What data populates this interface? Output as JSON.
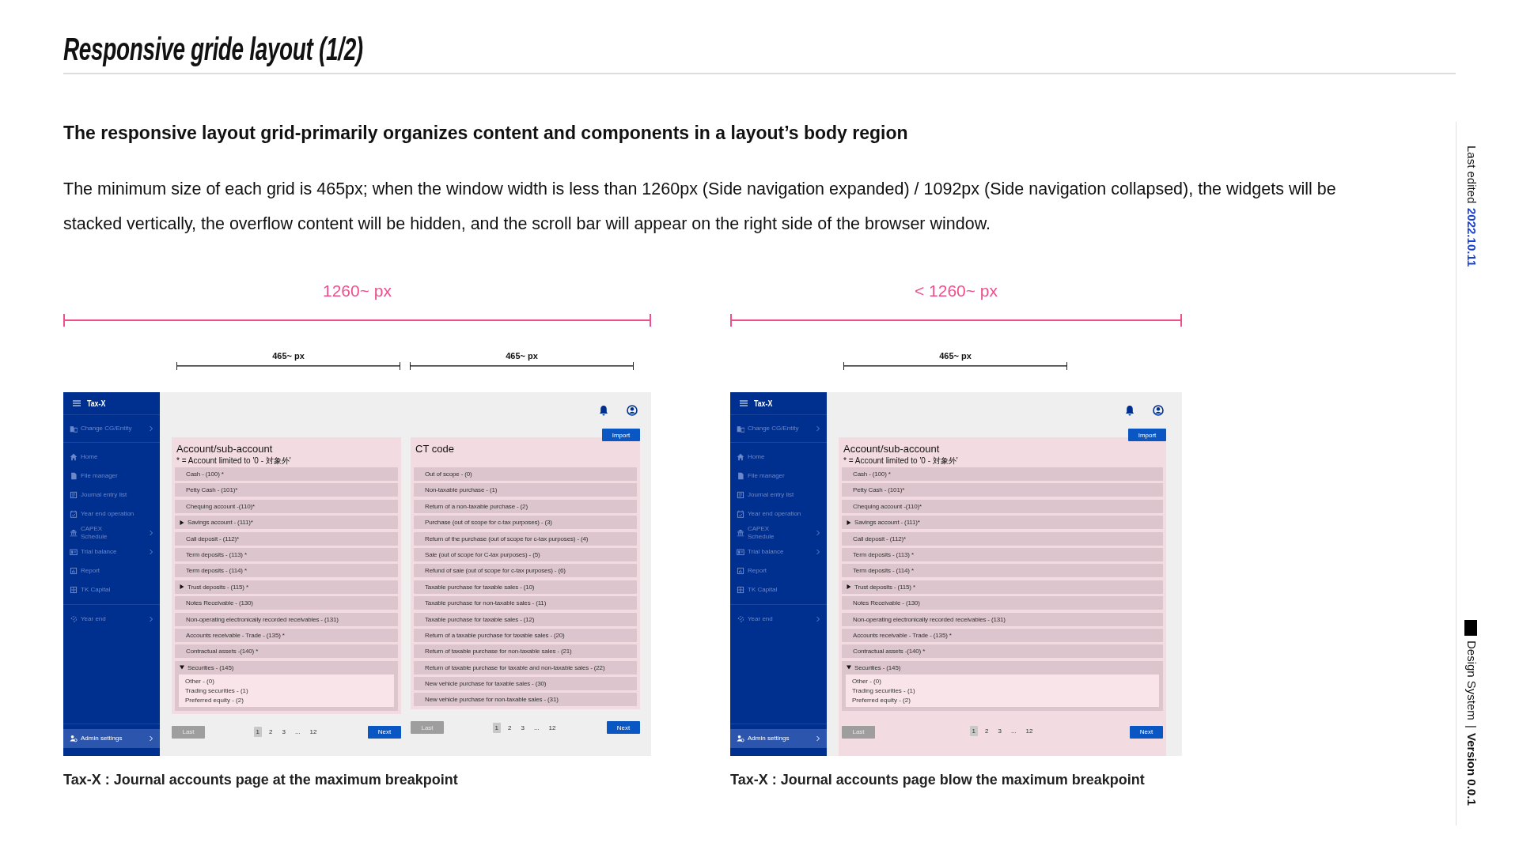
{
  "title": "Responsive gride layout (1/2)",
  "subtitle": "The responsive layout grid-primarily organizes content and components in a layout’s body region",
  "description": "The minimum size of each grid is 465px; when the window width is less than 1260px (Side navigation expanded) / 1092px (Side navigation collapsed), the widgets will be stacked vertically, the overflow content will be hidden, and the scroll bar will appear on the right side of the browser window.",
  "sections": [
    {
      "breakpoint_label": "1260~ px",
      "grid_labels": [
        "465~ px",
        "465~ px"
      ],
      "mockup": {
        "app_name": "Tax-X",
        "sidebar": {
          "groups": [
            {
              "items": [
                {
                  "label": "Change CG/Entity",
                  "submenu": true
                }
              ]
            },
            {
              "items": [
                {
                  "label": "Home",
                  "submenu": false
                },
                {
                  "label": "File manager",
                  "submenu": false
                },
                {
                  "label": "Journal entry list",
                  "submenu": false
                },
                {
                  "label": "Year end operation",
                  "submenu": false
                },
                {
                  "label": "CAPEX\nSchedule",
                  "submenu": true
                },
                {
                  "label": "Trial balance",
                  "submenu": true
                },
                {
                  "label": "Report",
                  "submenu": false
                },
                {
                  "label": "TK Capital",
                  "submenu": false
                }
              ]
            },
            {
              "items": [
                {
                  "label": "Year end",
                  "submenu": true
                }
              ]
            }
          ],
          "footer_item": {
            "label": "Admin settings",
            "submenu": true
          }
        },
        "import_button": "Import",
        "columns": [
          {
            "title": "Account/sub-account",
            "note": "* = Account limited to '0 - 対象外'",
            "rows": [
              {
                "label": "Cash - (100) *",
                "kind": "item"
              },
              {
                "label": "Petty Cash - (101)*",
                "kind": "item"
              },
              {
                "label": "Chequing account -(110)*",
                "kind": "item"
              },
              {
                "label": "Savings account - (111)*",
                "kind": "group",
                "expanded": false
              },
              {
                "label": "Call deposit - (112)*",
                "kind": "item"
              },
              {
                "label": "Term deposits - (113) *",
                "kind": "item"
              },
              {
                "label": "Term deposits - (114) *",
                "kind": "item"
              },
              {
                "label": "Trust deposits - (115) *",
                "kind": "group",
                "expanded": false
              },
              {
                "label": "Notes Receivable - (130)",
                "kind": "item"
              },
              {
                "label": "Non-operating electronically recorded receivables - (131)",
                "kind": "item"
              },
              {
                "label": "Accounts receivable - Trade - (135) *",
                "kind": "item"
              },
              {
                "label": "Contractual assets -(140) *",
                "kind": "item"
              },
              {
                "label": "Securities - (145)",
                "kind": "group",
                "expanded": true,
                "children": [
                  {
                    "label": "Other - (0)"
                  },
                  {
                    "label": "Trading securities - (1)"
                  },
                  {
                    "label": "Preferred equity - (2)"
                  }
                ]
              }
            ],
            "pagination": {
              "previous": {
                "label": "Last",
                "disabled": true
              },
              "pages": [
                {
                  "label": "1",
                  "selected": true
                },
                {
                  "label": "2",
                  "selected": false
                },
                {
                  "label": "3",
                  "selected": false
                },
                {
                  "label": "...",
                  "selected": false
                },
                {
                  "label": "12",
                  "selected": false
                }
              ],
              "next": {
                "label": "Next",
                "disabled": false
              }
            }
          },
          {
            "title": "CT code",
            "rows": [
              {
                "label": "Out of scope - (0)",
                "kind": "item"
              },
              {
                "label": "Non-taxable purchase - (1)",
                "kind": "item"
              },
              {
                "label": "Return of a non-taxable purchase - (2)",
                "kind": "item"
              },
              {
                "label": "Purchase (out of scope for c-tax purposes) - (3)",
                "kind": "item"
              },
              {
                "label": "Return of the purchase (out of scope for c-tax purposes) - (4)",
                "kind": "item"
              },
              {
                "label": "Sale (out of scope for C-tax purposes) - (5)",
                "kind": "item"
              },
              {
                "label": "Refund of sale (out of scope for c-tax purposes) - (6)",
                "kind": "item"
              },
              {
                "label": "Taxable purchase for taxable sales - (10)",
                "kind": "item"
              },
              {
                "label": "Taxable purchase for non-taxable sales - (11)",
                "kind": "item"
              },
              {
                "label": "Taxable purchase for taxable sales - (12)",
                "kind": "item"
              },
              {
                "label": "Return of a taxable purchase for taxable sales - (20)",
                "kind": "item"
              },
              {
                "label": "Return of taxable purchase for non-taxable sales - (21)",
                "kind": "item"
              },
              {
                "label": "Return of taxable purchase for taxable and non-taxable sales - (22)",
                "kind": "item"
              },
              {
                "label": "New vehicle purchase for taxable sales - (30)",
                "kind": "item"
              },
              {
                "label": "New vehicle purchase for non-taxable sales - (31)",
                "kind": "item"
              }
            ],
            "pagination": {
              "previous": {
                "label": "Last",
                "disabled": true
              },
              "pages": [
                {
                  "label": "1",
                  "selected": true
                },
                {
                  "label": "2",
                  "selected": false
                },
                {
                  "label": "3",
                  "selected": false
                },
                {
                  "label": "...",
                  "selected": false
                },
                {
                  "label": "12",
                  "selected": false
                }
              ],
              "next": {
                "label": "Next",
                "disabled": false
              }
            }
          }
        ]
      },
      "caption": "Tax-X : Journal accounts page at the maximum breakpoint"
    },
    {
      "breakpoint_label": "< 1260~ px",
      "grid_labels": [
        "465~ px"
      ],
      "mockup": {
        "app_name": "Tax-X",
        "sidebar": {
          "groups": [
            {
              "items": [
                {
                  "label": "Change CG/Entity",
                  "submenu": true
                }
              ]
            },
            {
              "items": [
                {
                  "label": "Home",
                  "submenu": false
                },
                {
                  "label": "File manager",
                  "submenu": false
                },
                {
                  "label": "Journal entry list",
                  "submenu": false
                },
                {
                  "label": "Year end operation",
                  "submenu": false
                },
                {
                  "label": "CAPEX\nSchedule",
                  "submenu": true
                },
                {
                  "label": "Trial balance",
                  "submenu": true
                },
                {
                  "label": "Report",
                  "submenu": false
                },
                {
                  "label": "TK Capital",
                  "submenu": false
                }
              ]
            },
            {
              "items": [
                {
                  "label": "Year end",
                  "submenu": true
                }
              ]
            }
          ],
          "footer_item": {
            "label": "Admin settings",
            "submenu": true
          }
        },
        "import_button": "Import",
        "columns": [
          {
            "title": "Account/sub-account",
            "note": "* = Account limited to '0 - 対象外'",
            "rows": [
              {
                "label": "Cash - (100) *",
                "kind": "item"
              },
              {
                "label": "Petty Cash - (101)*",
                "kind": "item"
              },
              {
                "label": "Chequing account -(110)*",
                "kind": "item"
              },
              {
                "label": "Savings account - (111)*",
                "kind": "group",
                "expanded": false
              },
              {
                "label": "Call deposit - (112)*",
                "kind": "item"
              },
              {
                "label": "Term deposits - (113) *",
                "kind": "item"
              },
              {
                "label": "Term deposits - (114) *",
                "kind": "item"
              },
              {
                "label": "Trust deposits - (115) *",
                "kind": "group",
                "expanded": false
              },
              {
                "label": "Notes Receivable - (130)",
                "kind": "item"
              },
              {
                "label": "Non-operating electronically recorded receivables - (131)",
                "kind": "item"
              },
              {
                "label": "Accounts receivable - Trade - (135) *",
                "kind": "item"
              },
              {
                "label": "Contractual assets -(140) *",
                "kind": "item"
              },
              {
                "label": "Securities - (145)",
                "kind": "group",
                "expanded": true,
                "children": [
                  {
                    "label": "Other - (0)"
                  },
                  {
                    "label": "Trading securities - (1)"
                  },
                  {
                    "label": "Preferred equity - (2)"
                  }
                ]
              }
            ],
            "pagination": {
              "previous": {
                "label": "Last",
                "disabled": true
              },
              "pages": [
                {
                  "label": "1",
                  "selected": true
                },
                {
                  "label": "2",
                  "selected": false
                },
                {
                  "label": "3",
                  "selected": false
                },
                {
                  "label": "...",
                  "selected": false
                },
                {
                  "label": "12",
                  "selected": false
                }
              ],
              "next": {
                "label": "Next",
                "disabled": false
              }
            }
          }
        ]
      },
      "caption": "Tax-X : Journal accounts page blow the maximum breakpoint"
    }
  ],
  "side_note": {
    "last_edited_label": "Last edited",
    "last_edited_date": "2022.10.11",
    "product": "Design System",
    "separator": "|",
    "version": "Version 0.0.1"
  }
}
